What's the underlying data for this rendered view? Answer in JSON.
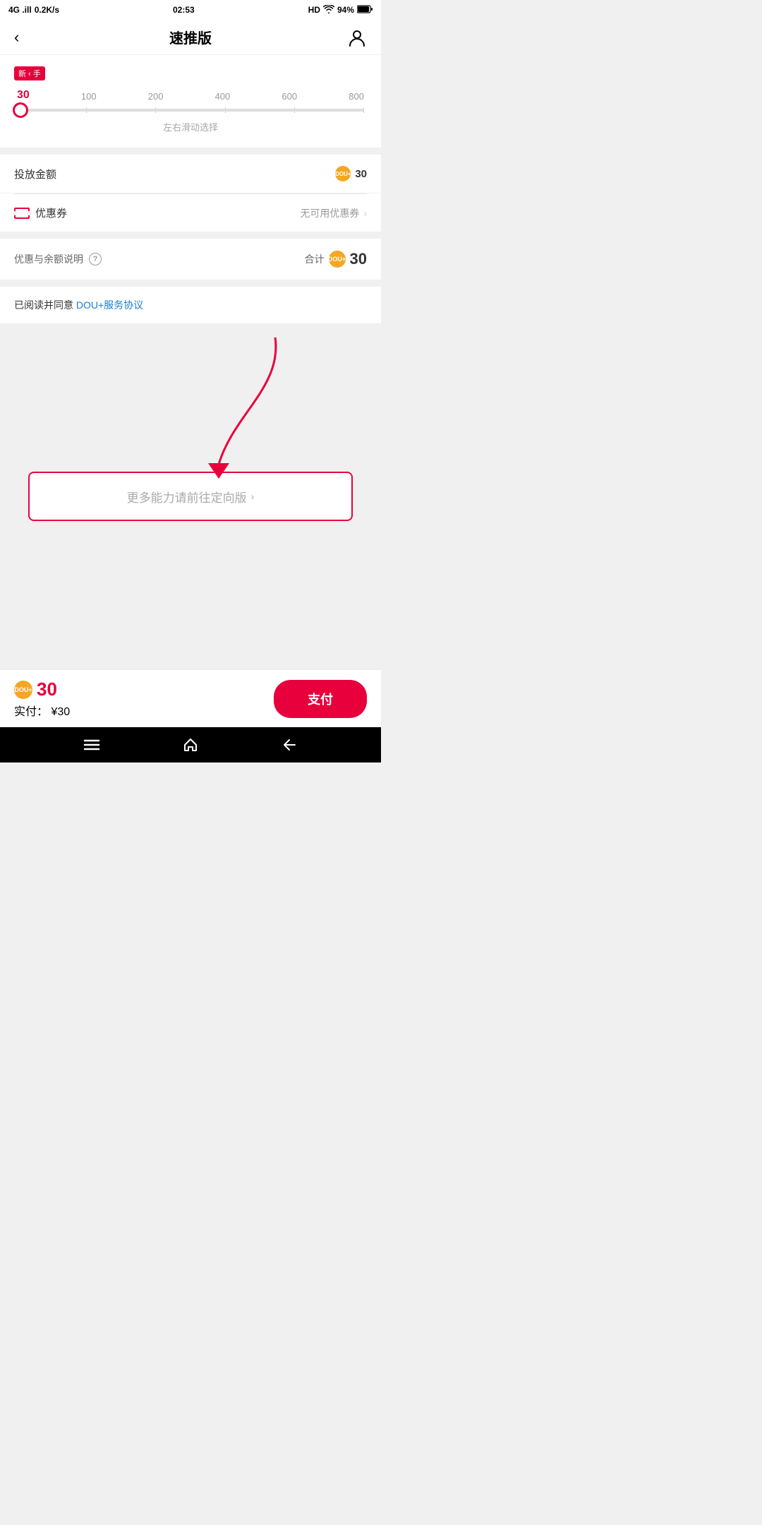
{
  "statusBar": {
    "network": "4G",
    "signal": "4G .ill",
    "speed": "0.2K/s",
    "time": "02:53",
    "alarm": "HD",
    "wifi": "94%",
    "battery": "94%"
  },
  "nav": {
    "backLabel": "‹",
    "title": "速推版",
    "userIconAlt": "user"
  },
  "slider": {
    "badgeText": "新 ‹ 手",
    "values": [
      "30",
      "100",
      "200",
      "400",
      "600",
      "800"
    ],
    "activeIndex": 0,
    "hintText": "左右滑动选择"
  },
  "amountRow": {
    "label": "投放金额",
    "value": "30"
  },
  "couponRow": {
    "label": "优惠券",
    "noAvailable": "无可用优惠券"
  },
  "totalSection": {
    "label": "优惠与余额说明",
    "totalLabel": "合计",
    "totalValue": "30"
  },
  "agreement": {
    "prefix": "已阅读并同意 ",
    "linkText": "DOU+服务协议"
  },
  "moreBtn": {
    "label": "更多能力请前往定向版",
    "chevron": "›"
  },
  "bottomBar": {
    "coinValue": "30",
    "actualLabel": "实付：",
    "actualValue": "¥30",
    "payLabel": "支付"
  },
  "icons": {
    "dou_text": "DOU+",
    "help_char": "?",
    "coupon_label": ""
  }
}
